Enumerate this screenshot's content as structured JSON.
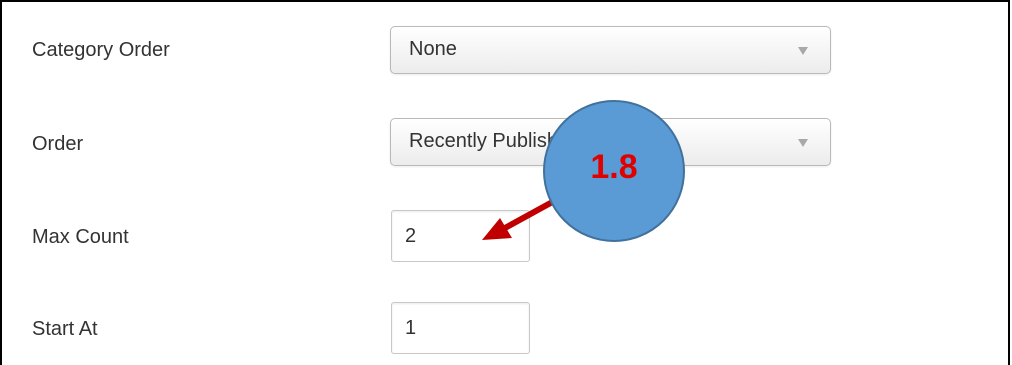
{
  "form": {
    "category_order": {
      "label": "Category Order",
      "value": "None"
    },
    "order": {
      "label": "Order",
      "value": "Recently Published First"
    },
    "max_count": {
      "label": "Max Count",
      "value": "2"
    },
    "start_at": {
      "label": "Start At",
      "value": "1"
    }
  },
  "annotation": {
    "label": "1.8",
    "bubble_color": "#5b9bd5",
    "text_color": "#e00000",
    "arrow_color": "#c00000"
  }
}
